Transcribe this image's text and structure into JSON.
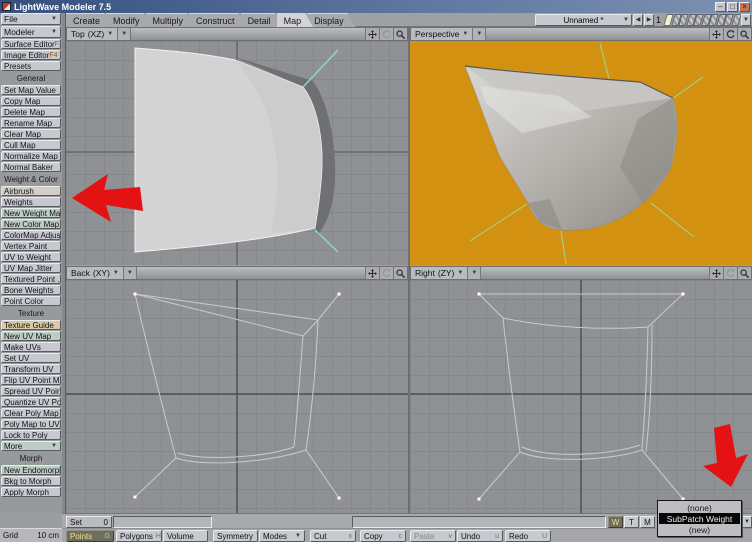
{
  "window": {
    "title": "LightWave Modeler 7.5"
  },
  "icons": {
    "caret_down": "▼",
    "prev": "◀",
    "next": "▶",
    "minimize": "–",
    "restore": "□",
    "close": "×"
  },
  "tabs": {
    "items": [
      "Create",
      "Modify",
      "Multiply",
      "Construct",
      "Detail",
      "Map",
      "Display"
    ],
    "active": "Map"
  },
  "object_bar": {
    "name_value": "Unnamed *",
    "bank_number": "1",
    "layer_count": 10,
    "active_layer": 1
  },
  "sidebar": {
    "file_menu": "File",
    "modeler_menu": "Modeler",
    "items": [
      {
        "type": "button",
        "label": "Surface Editor",
        "shortcut": "F3"
      },
      {
        "type": "button",
        "label": "Image Editor",
        "shortcut": "F4"
      },
      {
        "type": "button",
        "label": "Presets"
      },
      {
        "type": "header",
        "label": "General"
      },
      {
        "type": "button",
        "label": "Set Map Value"
      },
      {
        "type": "button",
        "label": "Copy Map"
      },
      {
        "type": "button",
        "label": "Delete Map"
      },
      {
        "type": "button",
        "label": "Rename Map"
      },
      {
        "type": "button",
        "label": "Clear Map"
      },
      {
        "type": "button",
        "label": "Cull Map"
      },
      {
        "type": "button",
        "label": "Normalize Map"
      },
      {
        "type": "button",
        "label": "Normal Baker"
      },
      {
        "type": "header",
        "label": "Weight & Color"
      },
      {
        "type": "button",
        "label": "Airbrush",
        "tint": "warm"
      },
      {
        "type": "button",
        "label": "Weights"
      },
      {
        "type": "button",
        "label": "New Weight Map",
        "tint": "green"
      },
      {
        "type": "button",
        "label": "New Color Map",
        "tint": "green"
      },
      {
        "type": "button",
        "label": "ColorMap Adjust ..."
      },
      {
        "type": "button",
        "label": "Vertex Paint"
      },
      {
        "type": "button",
        "label": "UV to Weight"
      },
      {
        "type": "button",
        "label": "UV Map Jitter"
      },
      {
        "type": "button",
        "label": "Textured Point ..."
      },
      {
        "type": "button",
        "label": "Bone Weights"
      },
      {
        "type": "button",
        "label": "Point Color"
      },
      {
        "type": "header",
        "label": "Texture"
      },
      {
        "type": "button",
        "label": "Texture Guide",
        "tint": "tan"
      },
      {
        "type": "button",
        "label": "New UV Map",
        "tint": "green"
      },
      {
        "type": "button",
        "label": "Make UVs"
      },
      {
        "type": "button",
        "label": "Set UV"
      },
      {
        "type": "button",
        "label": "Transform UV"
      },
      {
        "type": "button",
        "label": "Flip UV Point Map"
      },
      {
        "type": "button",
        "label": "Spread UV Point..."
      },
      {
        "type": "button",
        "label": "Quantize UV Poi..."
      },
      {
        "type": "button",
        "label": "Clear Poly Map"
      },
      {
        "type": "button",
        "label": "Poly Map to UVs"
      },
      {
        "type": "button",
        "label": "Lock to Poly"
      },
      {
        "type": "button",
        "label": "More",
        "dropdown": true,
        "tint": "green"
      },
      {
        "type": "header",
        "label": "Morph"
      },
      {
        "type": "button",
        "label": "New Endomorph",
        "tint": "green"
      },
      {
        "type": "button",
        "label": "Bkg to Morph"
      },
      {
        "type": "button",
        "label": "Apply Morph"
      }
    ]
  },
  "viewports": {
    "top": {
      "label": "Top",
      "axes": "(XZ)"
    },
    "perspective": {
      "label": "Perspective",
      "axes": ""
    },
    "back": {
      "label": "Back",
      "axes": "(XY)"
    },
    "right": {
      "label": "Right",
      "axes": "(ZY)"
    }
  },
  "status": {
    "grid_label": "Grid",
    "grid_value": "10 cm",
    "set_label": "Set",
    "set_value": "0"
  },
  "modes": [
    {
      "label": "Points",
      "shortcut": "G",
      "active": true
    },
    {
      "label": "Polygons",
      "shortcut": "H"
    },
    {
      "label": "Volume",
      "shortcut": ""
    },
    {
      "label": "Symmetry",
      "shortcut": "Y"
    },
    {
      "label": "Modes",
      "dropdown": true
    }
  ],
  "actions": [
    {
      "label": "Cut",
      "shortcut": "x"
    },
    {
      "label": "Copy",
      "shortcut": "c"
    },
    {
      "label": "Paste",
      "shortcut": "v",
      "disabled": true
    },
    {
      "label": "Undo",
      "shortcut": "u"
    },
    {
      "label": "Redo",
      "shortcut": "U"
    }
  ],
  "vmap": {
    "buttons": [
      {
        "label": "W",
        "active": true
      },
      {
        "label": "T"
      },
      {
        "label": "M"
      }
    ]
  },
  "vmap_popup": {
    "items": [
      {
        "label": "(none)"
      },
      {
        "label": "SubPatch Weight",
        "selected": true
      },
      {
        "label": "(new)"
      }
    ]
  },
  "colors": {
    "perspective_background": "#d29110",
    "annotation_red": "#e41212",
    "selection_bg": "#060606",
    "cyan_guide": "#8ed9dd",
    "green_guide": "#a7cd7e"
  }
}
